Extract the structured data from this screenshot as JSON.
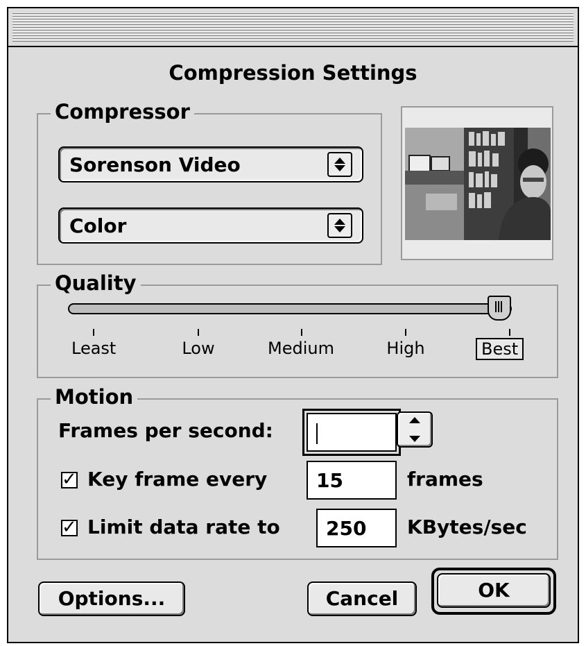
{
  "dialog": {
    "title": "Compression Settings"
  },
  "compressor": {
    "label": "Compressor",
    "codec_selected": "Sorenson Video",
    "depth_selected": "Color",
    "arrows_icon": "up-down-arrows-icon"
  },
  "quality": {
    "label": "Quality",
    "ticks": [
      "Least",
      "Low",
      "Medium",
      "High",
      "Best"
    ],
    "selected": "Best",
    "level_fraction": 1.0
  },
  "motion": {
    "label": "Motion",
    "fps_label": "Frames per second:",
    "fps_value": "",
    "keyframe_checked": true,
    "keyframe_label": "Key frame every",
    "keyframe_value": "15",
    "keyframe_unit": "frames",
    "datarate_checked": true,
    "datarate_label": "Limit data rate to",
    "datarate_value": "250",
    "datarate_unit": "KBytes/sec"
  },
  "buttons": {
    "options": "Options...",
    "cancel": "Cancel",
    "ok": "OK"
  },
  "colors": {
    "window_bg": "#dcdcdc",
    "group_border": "#9a9a9a"
  }
}
